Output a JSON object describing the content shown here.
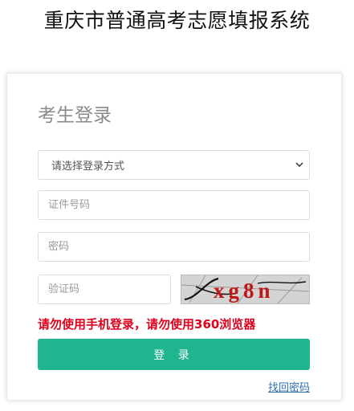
{
  "page": {
    "title": "重庆市普通高考志愿填报系统"
  },
  "login": {
    "heading": "考生登录",
    "method_select": {
      "selected": "请选择登录方式",
      "options": [
        "请选择登录方式"
      ]
    },
    "id_field": {
      "placeholder": "证件号码",
      "value": ""
    },
    "password_field": {
      "placeholder": "密码",
      "value": ""
    },
    "captcha_field": {
      "placeholder": "验证码",
      "value": ""
    },
    "captcha_image": {
      "text": "xg8n",
      "icon": "captcha-image"
    },
    "warning": "请勿使用手机登录，请勿使用360浏览器",
    "submit_label": "登 录",
    "forgot_link": "找回密码"
  },
  "colors": {
    "accent_button": "#1fb58e",
    "warning_text": "#e0001b",
    "link": "#2f6fb5",
    "captcha_text": "#c01818"
  }
}
